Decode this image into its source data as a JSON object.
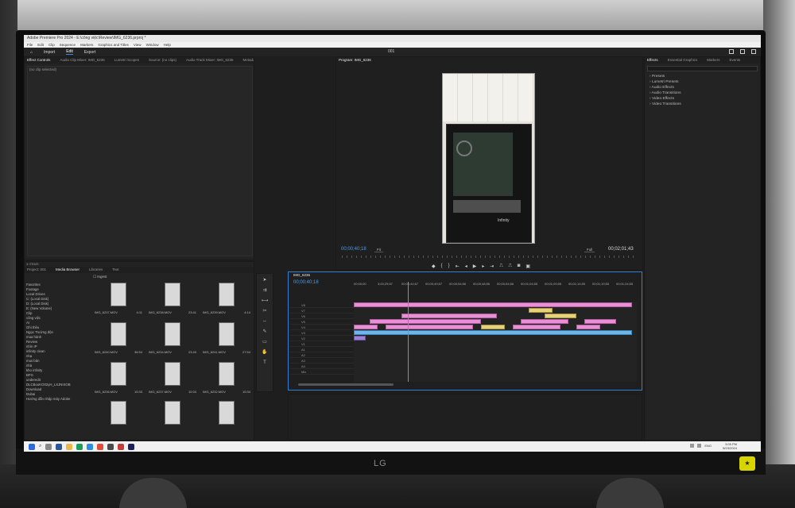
{
  "window": {
    "title": "Adobe Premiere Pro 2024 - E:\\công việc\\Review\\IMG_6236.prproj *",
    "menu": [
      "File",
      "Edit",
      "Clip",
      "Sequence",
      "Markers",
      "Graphics and Titles",
      "View",
      "Window",
      "Help"
    ],
    "center_title": "001"
  },
  "workspace": {
    "tabs": [
      "Import",
      "Edit",
      "Export"
    ],
    "active_tab": "Edit"
  },
  "source_panel": {
    "tabs": [
      "Effect Controls",
      "Audio Clip Mixer: IMG_6236",
      "Lumetri Scopes",
      "Source: (no clips)",
      "Audio Track Mixer: IMG_6236",
      "Metadata: IMG_6236"
    ],
    "no_clip_label": "(no clip selected)"
  },
  "program_panel": {
    "tab": "Program: IMG_6236",
    "timecode_current": "00;00;40;18",
    "timecode_duration": "00;02;01;43",
    "fit_left": "Fit",
    "fit_right": "Full",
    "case_logo": "Infinity"
  },
  "effects_panel": {
    "tabs": [
      "Effects",
      "Essential Graphics",
      "Markers",
      "Events"
    ],
    "items": [
      "Presets",
      "Lumetri Presets",
      "Audio Effects",
      "Audio Transitions",
      "Video Effects",
      "Video Transitions"
    ]
  },
  "project_panel": {
    "tabs": [
      "Project: 001",
      "Media Browser",
      "Libraries",
      "Text"
    ],
    "ingest_label": "Ingest",
    "count_label": "3 ITEMS",
    "tree": [
      "Favorites",
      "Footage",
      "Local Drives",
      "C: (Local Disk)",
      "D: (Local Disk)",
      "E: (New Volume)",
      "Clip",
      "công việc",
      "AI",
      "Ghi thêu",
      "Ngọc Trường độn",
      "mua hành",
      "Review",
      "nhìn IP",
      "infinity clean",
      "nhạ",
      "mus bản",
      "nhà",
      "kho infinity",
      "BFG",
      "underedit",
      "DLCBooKO02yH_LXJNIXOB",
      "Download",
      "Dubai",
      "Hướng dẫn nhập máy Adobe"
    ],
    "clips": [
      {
        "name": "IMG_6237.MOV",
        "dur": "4:11"
      },
      {
        "name": "IMG_6238.MOV",
        "dur": "23:41"
      },
      {
        "name": "IMG_6239.MOV",
        "dur": "4:14"
      },
      {
        "name": "IMG_6240.MOV",
        "dur": "36:54"
      },
      {
        "name": "IMG_6234.MOV",
        "dur": "23:40"
      },
      {
        "name": "IMG_6241.MOV",
        "dur": "27:54"
      },
      {
        "name": "IMG_6236.MOV",
        "dur": "10:33"
      },
      {
        "name": "IMG_6237.MOV",
        "dur": "10:34"
      },
      {
        "name": "IMG_6232.MOV",
        "dur": "10:34"
      },
      {
        "name": "",
        "dur": ""
      },
      {
        "name": "",
        "dur": ""
      },
      {
        "name": "",
        "dur": ""
      }
    ]
  },
  "timeline": {
    "tab": "IMG_6236",
    "timecode": "00;00;40;18",
    "ruler": [
      "00;00;00",
      "3;00;29;57",
      "00;00;44;57",
      "00;00;49;57",
      "00;00;54;56",
      "00;00;48;56",
      "00;00;54;56",
      "00;01;04;55",
      "00;01;09;55",
      "00;01;14;55",
      "00;01;19;55",
      "00;01;24;55"
    ],
    "tracks": [
      "V8",
      "V7",
      "V6",
      "V5",
      "V4",
      "V3",
      "V2",
      "V1",
      "A1",
      "A2",
      "A3",
      "A4",
      "Mix"
    ]
  },
  "taskbar": {
    "search_label": "⌕",
    "time": "3:05 PM",
    "date": "8/23/2024",
    "lang": "ENG"
  },
  "bezel": {
    "brand": "LG"
  },
  "colors": {
    "accent": "#3fa0ff",
    "clip_pink": "#e98fd6",
    "clip_yellow": "#e6d27a",
    "clip_blue": "#6fb6e6"
  }
}
